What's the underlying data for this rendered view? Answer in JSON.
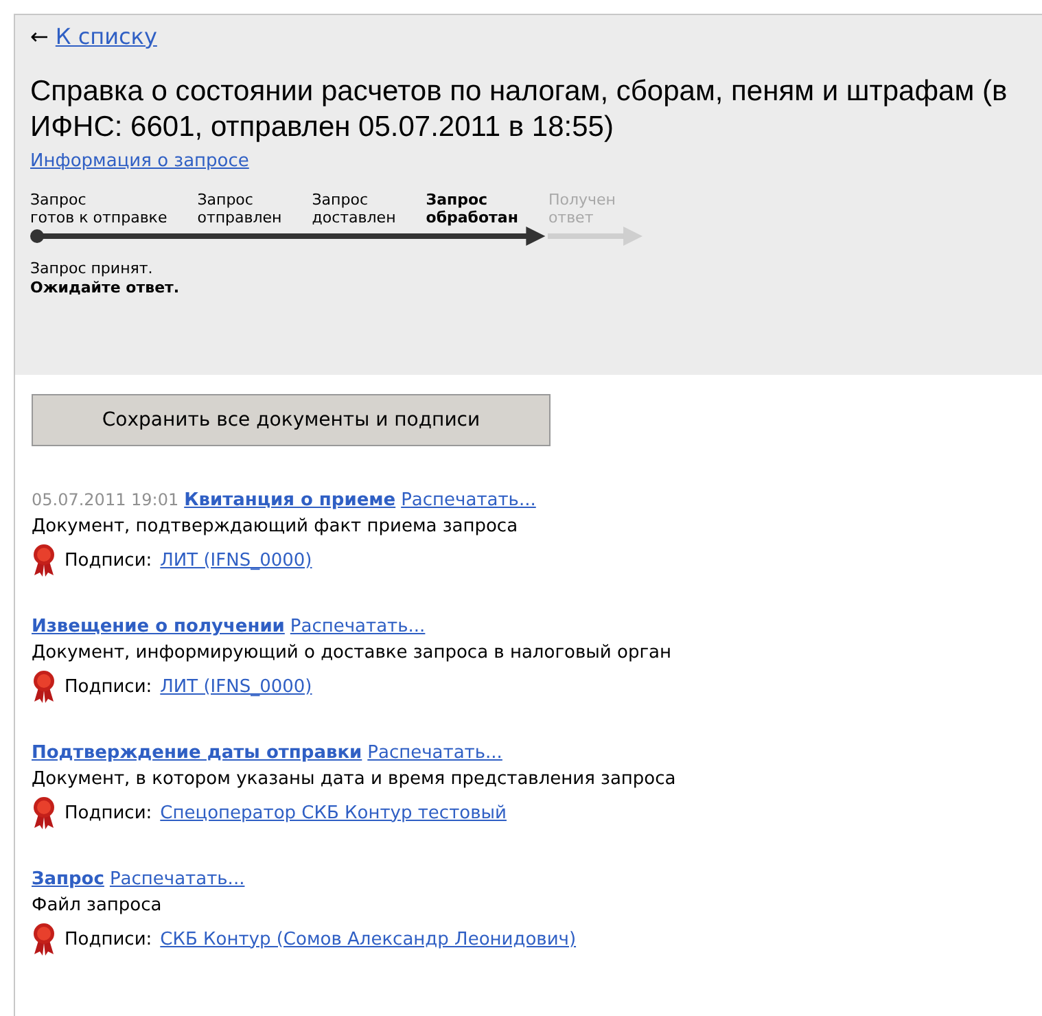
{
  "back_link": {
    "arrow": "←",
    "label": "К списку"
  },
  "title": "Справка о состоянии расчетов по налогам, сборам, пеням и штрафам (в ИФНС: 6601, отправлен 05.07.2011 в 18:55)",
  "info_link": "Информация о запросе",
  "steps": [
    {
      "line1": "Запрос",
      "line2": "готов к отправке",
      "kind": "done"
    },
    {
      "line1": "Запрос",
      "line2": "отправлен",
      "kind": "done"
    },
    {
      "line1": "Запрос",
      "line2": "доставлен",
      "kind": "done"
    },
    {
      "line1": "Запрос",
      "line2": "обработан",
      "kind": "current"
    },
    {
      "line1": "Получен",
      "line2": "ответ",
      "kind": "pending"
    }
  ],
  "status": {
    "line1": "Запрос принят.",
    "line2": "Ожидайте ответ."
  },
  "save_button": "Сохранить все документы и подписи",
  "documents": [
    {
      "date": "05.07.2011 19:01",
      "title": "Квитанция о приеме",
      "print": "Распечатать...",
      "description": "Документ, подтверждающий факт приема запроса",
      "signatures_label": "Подписи:",
      "signer": "ЛИТ (IFNS_0000)"
    },
    {
      "title": "Извещение о получении",
      "print": "Распечатать...",
      "description": "Документ, информирующий о доставке запроса в налоговый орган",
      "signatures_label": "Подписи:",
      "signer": "ЛИТ (IFNS_0000)"
    },
    {
      "title": "Подтверждение даты отправки",
      "print": "Распечатать...",
      "description": "Документ, в котором указаны дата и время представления запроса",
      "signatures_label": "Подписи:",
      "signer": "Спецоператор СКБ Контур тестовый"
    },
    {
      "title": "Запрос",
      "print": "Распечатать...",
      "description": "Файл запроса",
      "signatures_label": "Подписи:",
      "signer": "СКБ Контур (Сомов Александр Леонидович)"
    }
  ]
}
